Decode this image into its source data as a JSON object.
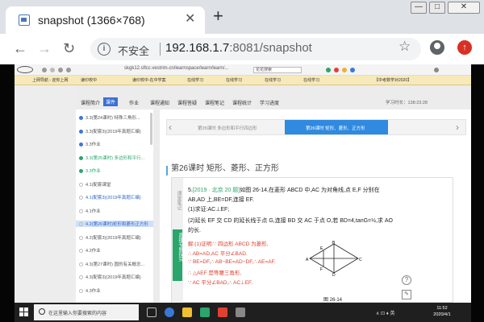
{
  "browser": {
    "tab_title": "snapshot (1366×768)",
    "tab_close": "✕",
    "new_tab": "+",
    "security_label": "不安全",
    "address_host": "192.168.1.7",
    "address_path": ":8081/snapshot",
    "window_min": "—",
    "window_max": "□",
    "window_close": "✕"
  },
  "remote_browser": {
    "url": "skgk12.sflcc.vestrim.cn/learnspace/learn/learn/...",
    "search_placeholder": "花花搜索",
    "tabs": [
      "上网导航 - 迎你上网",
      "谦印校中",
      "谦印校中-在中学案",
      "在线学习",
      "在线学习",
      "在线学习",
      "在线学习",
      "【中考数学对2020】"
    ]
  },
  "course": {
    "nav": [
      "课程简介",
      "课件",
      "作业",
      "课程通知",
      "课程答疑",
      "课程笔记",
      "课程统计",
      "学习进度"
    ],
    "active_nav_index": 1,
    "study_time": "学习时长：138:23:28",
    "sidebar": [
      {
        "label": "3.3(第24课时)  特殊三角形...",
        "state": "done"
      },
      {
        "label": "3.3(配套3)(2019年真题汇编)",
        "state": "done"
      },
      {
        "label": "3.3作业",
        "state": "done"
      },
      {
        "label": "3.3(第25课时) 多边形和平行...",
        "state": "cur"
      },
      {
        "label": "3.3作业",
        "state": "cur"
      },
      {
        "label": "4.1(配套课堂",
        "state": "todo"
      },
      {
        "label": "4.1(配套3)(2019年真题汇编)",
        "state": "todo-blue"
      },
      {
        "label": "4.1作业",
        "state": "todo"
      },
      {
        "label": "4.2(第26课时)矩形和菱形正方形",
        "state": "active"
      },
      {
        "label": "4.2(配套3)(2019年真题汇编)",
        "state": "todo"
      },
      {
        "label": "4.2作业",
        "state": "todo"
      },
      {
        "label": "4.3(第27课时)  圆的有关概念...",
        "state": "todo"
      },
      {
        "label": "4.3(配套3)(2019年真题汇编)",
        "state": "todo"
      },
      {
        "label": "4.3作业",
        "state": "todo"
      }
    ],
    "prev_lesson": "第25课时 多边形和平行四边形",
    "current_lesson_tab": "第26课时  矩形、菱形、正方形",
    "prev_arrow": "‹",
    "next_arrow": "›",
    "lesson_title": "第26课时   矩形、菱形、正方形",
    "doc_side_top": "课堂笔记",
    "doc_side_bottom": "直播专题探究",
    "question": {
      "num": "5.",
      "source": "[2019 · 北京 20 题]",
      "line1": "如图 26-14,在菱形 ABCD 中,AC 为对角线,点 E,F 分别在",
      "line2": "AB,AD 上,BE=DF,连接 EF.",
      "line3": "(1)求证:AC⊥EF;",
      "line4": "(2)延长 EF 交 CD 的延长线于点 G,连接 BD 交 AC 于点 O,若 BD=4,tanG=½,求 AO",
      "line5": "的长."
    },
    "solution": [
      "解:(1)证明:∵ 四边形 ABCD 为菱形,",
      "∴ AB=AD,AC 平分∠BAD.",
      "∵ BE=DF,∴ AB−BE=AD−DF,∴ AE=AF.",
      "∴ △AEF 是等腰三角形,",
      "∵ AC 平分∠BAD,∴ AC⊥EF."
    ],
    "figure_caption": "图 26-14",
    "figure_points": [
      "A",
      "B",
      "C",
      "D",
      "E",
      "F"
    ],
    "help_icon": "?",
    "edit_icon": "✎"
  },
  "taskbar": {
    "search_text": "在这里输入你要搜索的内容",
    "tray": "∧  ⊡  ♦  英",
    "time": "11:52",
    "date": "2020/4/1"
  }
}
